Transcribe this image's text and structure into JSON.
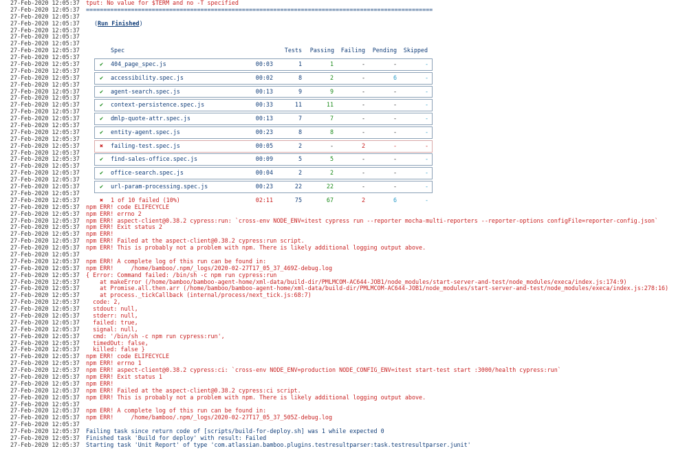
{
  "timestamp": "27-Feb-2020 12:05:37",
  "preamble": {
    "tput_warning": "tput: No value for $TERM and no -T specified",
    "divider": "====================================================================================================",
    "run_finished_open": "(",
    "run_finished_label": "Run Finished",
    "run_finished_close": ")"
  },
  "results_table": {
    "headers": {
      "spec": "Spec",
      "tests": "Tests",
      "passing": "Passing",
      "failing": "Failing",
      "pending": "Pending",
      "skipped": "Skipped"
    },
    "rows": [
      {
        "status": "pass",
        "icon": "✔",
        "spec": "404_page_spec.js",
        "time": "00:03",
        "tests": "1",
        "passing": "1",
        "failing": "-",
        "pending": "-",
        "skipped": "-"
      },
      {
        "status": "pass",
        "icon": "✔",
        "spec": "accessibility.spec.js",
        "time": "00:02",
        "tests": "8",
        "passing": "2",
        "failing": "-",
        "pending": "6",
        "skipped": "-"
      },
      {
        "status": "pass",
        "icon": "✔",
        "spec": "agent-search.spec.js",
        "time": "00:13",
        "tests": "9",
        "passing": "9",
        "failing": "-",
        "pending": "-",
        "skipped": "-"
      },
      {
        "status": "pass",
        "icon": "✔",
        "spec": "context-persistence.spec.js",
        "time": "00:33",
        "tests": "11",
        "passing": "11",
        "failing": "-",
        "pending": "-",
        "skipped": "-"
      },
      {
        "status": "pass",
        "icon": "✔",
        "spec": "dmlp-quote-attr.spec.js",
        "time": "00:13",
        "tests": "7",
        "passing": "7",
        "failing": "-",
        "pending": "-",
        "skipped": "-"
      },
      {
        "status": "pass",
        "icon": "✔",
        "spec": "entity-agent.spec.js",
        "time": "00:23",
        "tests": "8",
        "passing": "8",
        "failing": "-",
        "pending": "-",
        "skipped": "-"
      },
      {
        "status": "fail",
        "icon": "✖",
        "spec": "failing-test.spec.js",
        "time": "00:05",
        "tests": "2",
        "passing": "-",
        "failing": "2",
        "pending": "-",
        "skipped": "-"
      },
      {
        "status": "pass",
        "icon": "✔",
        "spec": "find-sales-office.spec.js",
        "time": "00:09",
        "tests": "5",
        "passing": "5",
        "failing": "-",
        "pending": "-",
        "skipped": "-"
      },
      {
        "status": "pass",
        "icon": "✔",
        "spec": "office-search.spec.js",
        "time": "00:04",
        "tests": "2",
        "passing": "2",
        "failing": "-",
        "pending": "-",
        "skipped": "-"
      },
      {
        "status": "pass",
        "icon": "✔",
        "spec": "url-param-processing.spec.js",
        "time": "00:23",
        "tests": "22",
        "passing": "22",
        "failing": "-",
        "pending": "-",
        "skipped": "-"
      }
    ],
    "summary": {
      "icon": "✖",
      "label": "1 of 10 failed (10%)",
      "time": "02:11",
      "tests": "75",
      "passing": "67",
      "failing": "2",
      "pending": "6",
      "skipped": "-"
    }
  },
  "error_lines": [
    "npm ERR! code ELIFECYCLE",
    "npm ERR! errno 2",
    "npm ERR! aspect-client@0.38.2 cypress:run: `cross-env NODE_ENV=itest cypress run --reporter mocha-multi-reporters --reporter-options configFile=reporter-config.json`",
    "npm ERR! Exit status 2",
    "npm ERR!",
    "npm ERR! Failed at the aspect-client@0.38.2 cypress:run script.",
    "npm ERR! This is probably not a problem with npm. There is likely additional logging output above.",
    "",
    "npm ERR! A complete log of this run can be found in:",
    "npm ERR!     /home/bamboo/.npm/_logs/2020-02-27T17_05_37_469Z-debug.log",
    "{ Error: Command failed: /bin/sh -c npm run cypress:run",
    "    at makeError (/home/bamboo/bamboo-agent-home/xml-data/build-dir/PMLMCOM-AC644-JOB1/node_modules/start-server-and-test/node_modules/execa/index.js:174:9)",
    "    at Promise.all.then.arr (/home/bamboo/bamboo-agent-home/xml-data/build-dir/PMLMCOM-AC644-JOB1/node_modules/start-server-and-test/node_modules/execa/index.js:278:16)",
    "    at process._tickCallback (internal/process/next_tick.js:68:7)",
    "  code: 2,",
    "  stdout: null,",
    "  stderr: null,",
    "  failed: true,",
    "  signal: null,",
    "  cmd: '/bin/sh -c npm run cypress:run',",
    "  timedOut: false,",
    "  killed: false }",
    "npm ERR! code ELIFECYCLE",
    "npm ERR! errno 1",
    "npm ERR! aspect-client@0.38.2 cypress:ci: `cross-env NODE_ENV=production NODE_CONFIG_ENV=itest start-test start :3000/health cypress:run`",
    "npm ERR! Exit status 1",
    "npm ERR!",
    "npm ERR! Failed at the aspect-client@0.38.2 cypress:ci script.",
    "npm ERR! This is probably not a problem with npm. There is likely additional logging output above.",
    "",
    "npm ERR! A complete log of this run can be found in:",
    "npm ERR!     /home/bamboo/.npm/_logs/2020-02-27T17_05_37_505Z-debug.log"
  ],
  "footer_lines": [
    "",
    "Failing task since return code of [scripts/build-for-deploy.sh] was 1 while expected 0",
    "Finished task 'Build for deploy' with result: Failed",
    "Starting task 'Unit Report' of type 'com.atlassian.bamboo.plugins.testresultparser:task.testresultparser.junit'"
  ],
  "colors": {
    "error": "#c81e1e",
    "info": "#0f3c78",
    "pass": "#1a8a1a",
    "pending": "#2a9bc8"
  }
}
